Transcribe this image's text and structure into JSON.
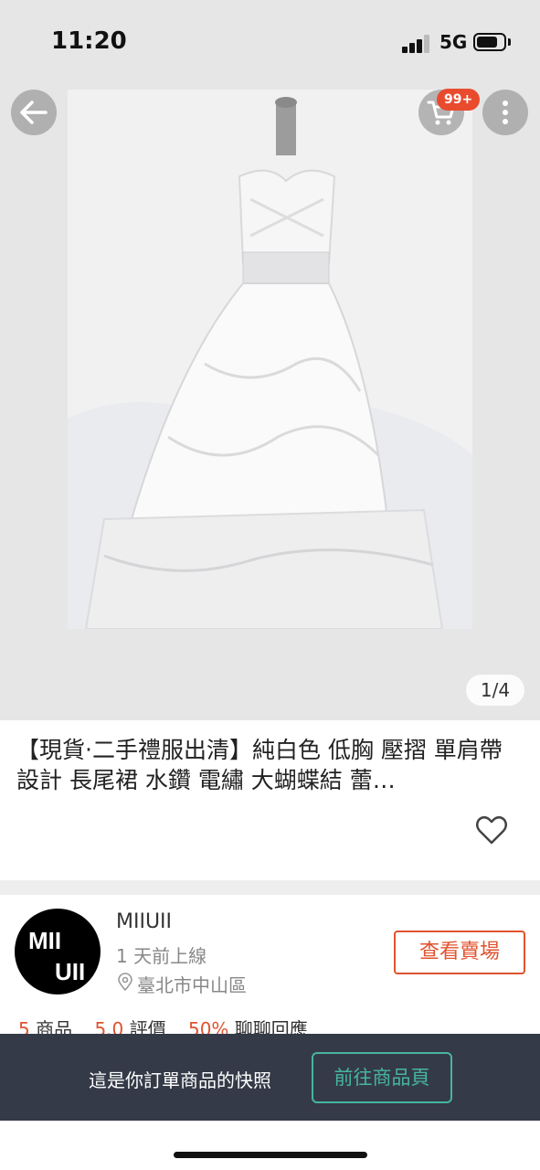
{
  "status_bar": {
    "time": "11:20",
    "network": "5G",
    "battery_level": 0.8
  },
  "gallery": {
    "cart_badge": "99+",
    "page_indicator": "1/4",
    "icons": {
      "back": "arrow-left-icon",
      "cart": "cart-icon",
      "more": "more-vertical-icon"
    }
  },
  "product": {
    "title": "【現貨‧二手禮服出清】純白色 低胸 壓摺 單肩帶設計 長尾裙 水鑽 電繡 大蝴蝶結 蕾…",
    "favorite_icon": "heart-outline-icon"
  },
  "shop": {
    "avatar_line1": "MII",
    "avatar_line2": "UII",
    "name": "MIIUII",
    "last_online": "1 天前上線",
    "location": "臺北市中山區",
    "visit_button": "查看賣場",
    "stats": {
      "products_count": "5",
      "products_label": "商品",
      "rating": "5.0",
      "rating_label": "評價",
      "response_rate": "50%",
      "response_label": "聊聊回應"
    }
  },
  "snapshot": {
    "notice": "這是你訂單商品的快照",
    "button": "前往商品頁"
  },
  "colors": {
    "accent": "#e0532f",
    "teal": "#46b5a0",
    "bar": "#353a48",
    "badge": "#e94b2f"
  }
}
